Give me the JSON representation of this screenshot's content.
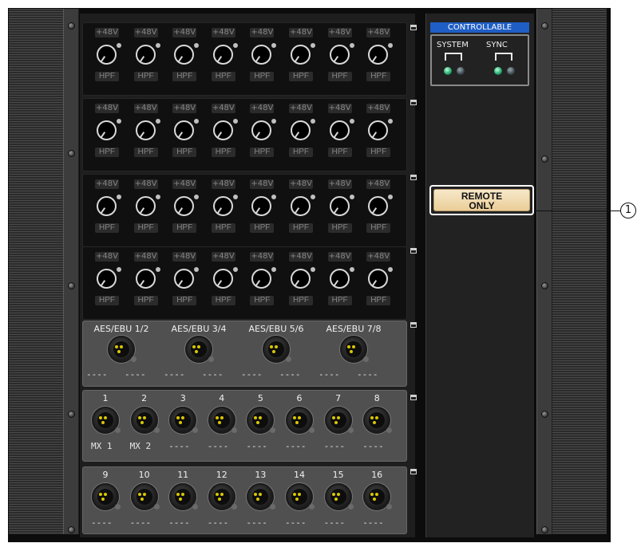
{
  "mic_cards": [
    {
      "slots": [
        {
          "phantom": "+48V",
          "hpf": "HPF"
        },
        {
          "phantom": "+48V",
          "hpf": "HPF"
        },
        {
          "phantom": "+48V",
          "hpf": "HPF"
        },
        {
          "phantom": "+48V",
          "hpf": "HPF"
        },
        {
          "phantom": "+48V",
          "hpf": "HPF"
        },
        {
          "phantom": "+48V",
          "hpf": "HPF"
        },
        {
          "phantom": "+48V",
          "hpf": "HPF"
        },
        {
          "phantom": "+48V",
          "hpf": "HPF"
        }
      ]
    },
    {
      "slots": [
        {
          "phantom": "+48V",
          "hpf": "HPF"
        },
        {
          "phantom": "+48V",
          "hpf": "HPF"
        },
        {
          "phantom": "+48V",
          "hpf": "HPF"
        },
        {
          "phantom": "+48V",
          "hpf": "HPF"
        },
        {
          "phantom": "+48V",
          "hpf": "HPF"
        },
        {
          "phantom": "+48V",
          "hpf": "HPF"
        },
        {
          "phantom": "+48V",
          "hpf": "HPF"
        },
        {
          "phantom": "+48V",
          "hpf": "HPF"
        }
      ]
    },
    {
      "slots": [
        {
          "phantom": "+48V",
          "hpf": "HPF"
        },
        {
          "phantom": "+48V",
          "hpf": "HPF"
        },
        {
          "phantom": "+48V",
          "hpf": "HPF"
        },
        {
          "phantom": "+48V",
          "hpf": "HPF"
        },
        {
          "phantom": "+48V",
          "hpf": "HPF"
        },
        {
          "phantom": "+48V",
          "hpf": "HPF"
        },
        {
          "phantom": "+48V",
          "hpf": "HPF"
        },
        {
          "phantom": "+48V",
          "hpf": "HPF"
        }
      ]
    },
    {
      "slots": [
        {
          "phantom": "+48V",
          "hpf": "HPF"
        },
        {
          "phantom": "+48V",
          "hpf": "HPF"
        },
        {
          "phantom": "+48V",
          "hpf": "HPF"
        },
        {
          "phantom": "+48V",
          "hpf": "HPF"
        },
        {
          "phantom": "+48V",
          "hpf": "HPF"
        },
        {
          "phantom": "+48V",
          "hpf": "HPF"
        },
        {
          "phantom": "+48V",
          "hpf": "HPF"
        },
        {
          "phantom": "+48V",
          "hpf": "HPF"
        }
      ]
    }
  ],
  "aes_card": {
    "ports": [
      {
        "label": "AES/EBU 1/2",
        "left": "----",
        "right": "----"
      },
      {
        "label": "AES/EBU 3/4",
        "left": "----",
        "right": "----"
      },
      {
        "label": "AES/EBU 5/6",
        "left": "----",
        "right": "----"
      },
      {
        "label": "AES/EBU 7/8",
        "left": "----",
        "right": "----"
      }
    ]
  },
  "output_card_1": {
    "ports": [
      {
        "number": "1",
        "patch": "MX 1"
      },
      {
        "number": "2",
        "patch": "MX 2"
      },
      {
        "number": "3",
        "patch": "----"
      },
      {
        "number": "4",
        "patch": "----"
      },
      {
        "number": "5",
        "patch": "----"
      },
      {
        "number": "6",
        "patch": "----"
      },
      {
        "number": "7",
        "patch": "----"
      },
      {
        "number": "8",
        "patch": "----"
      }
    ]
  },
  "output_card_2": {
    "ports": [
      {
        "number": "9",
        "patch": "----"
      },
      {
        "number": "10",
        "patch": "----"
      },
      {
        "number": "11",
        "patch": "----"
      },
      {
        "number": "12",
        "patch": "----"
      },
      {
        "number": "13",
        "patch": "----"
      },
      {
        "number": "14",
        "patch": "----"
      },
      {
        "number": "15",
        "patch": "----"
      },
      {
        "number": "16",
        "patch": "----"
      }
    ]
  },
  "status_panel": {
    "title": "CONTROLLABLE",
    "system_label": "SYSTEM",
    "sync_label": "SYNC",
    "system_leds": [
      "on",
      "off"
    ],
    "sync_leds": [
      "on",
      "off"
    ]
  },
  "remote_button": {
    "line1": "REMOTE",
    "line2": "ONLY"
  },
  "callout": {
    "number": "1"
  },
  "colors": {
    "controllable_bg": "#1f5ec4",
    "led_on": "#1fa36a",
    "remote_button": "#eacd98",
    "xlr_pin": "#d9c800"
  }
}
